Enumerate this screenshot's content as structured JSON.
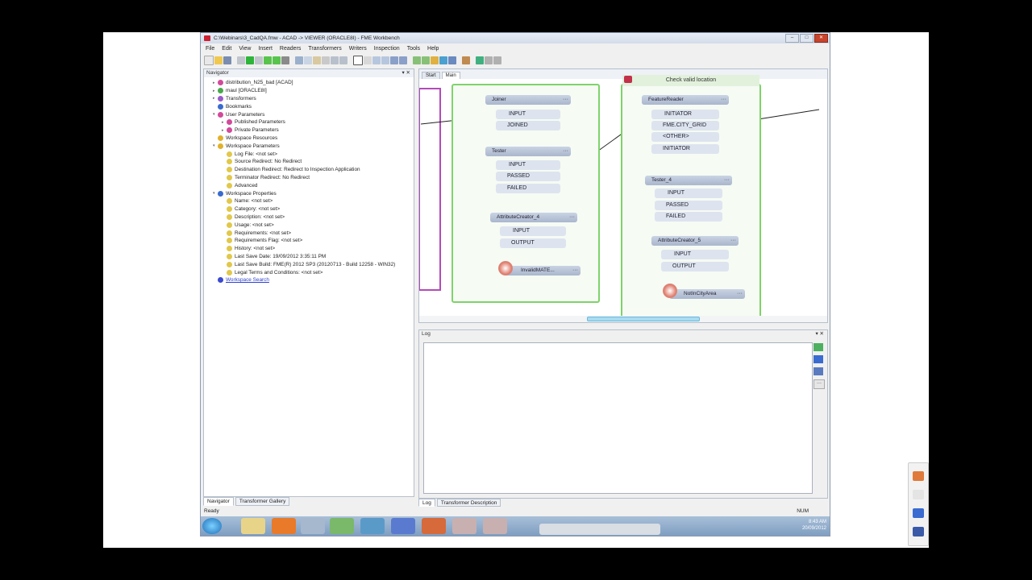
{
  "window": {
    "title": "C:\\Webinars\\3_CadQA.fmw - ACAD -> VIEWER (ORACLE8I) - FME Workbench"
  },
  "menu": [
    "File",
    "Edit",
    "View",
    "Insert",
    "Readers",
    "Transformers",
    "Writers",
    "Inspection",
    "Tools",
    "Help"
  ],
  "navigator": {
    "title": "Navigator",
    "items": [
      {
        "label": "distribution_N25_bad [ACAD]",
        "color": "#d24a9a"
      },
      {
        "label": "maul [ORACLE8I]",
        "color": "#4aa84a"
      },
      {
        "label": "Transformers",
        "color": "#9a5ac8"
      },
      {
        "label": "Bookmarks",
        "color": "#3a6bd0"
      },
      {
        "label": "User Parameters",
        "color": "#d24a9a"
      },
      {
        "label": "Published Parameters",
        "color": "#d24a9a"
      },
      {
        "label": "Private Parameters",
        "color": "#d24a9a"
      },
      {
        "label": "Workspace Resources",
        "color": "#e1b12c"
      },
      {
        "label": "Workspace Parameters",
        "color": "#e1b12c"
      },
      {
        "label": "Log File: <not set>",
        "color": "#e1c84a"
      },
      {
        "label": "Source Redirect: No Redirect",
        "color": "#e1c84a"
      },
      {
        "label": "Destination Redirect: Redirect to Inspection Application",
        "color": "#e1c84a"
      },
      {
        "label": "Terminator Redirect: No Redirect",
        "color": "#e1c84a"
      },
      {
        "label": "Advanced",
        "color": "#e1c84a"
      },
      {
        "label": "Workspace Properties",
        "color": "#3a6bd0"
      },
      {
        "label": "Name: <not set>",
        "color": "#e1c84a"
      },
      {
        "label": "Category: <not set>",
        "color": "#e1c84a"
      },
      {
        "label": "Description: <not set>",
        "color": "#e1c84a"
      },
      {
        "label": "Usage: <not set>",
        "color": "#e1c84a"
      },
      {
        "label": "Requirements: <not set>",
        "color": "#e1c84a"
      },
      {
        "label": "Requirements Flag: <not set>",
        "color": "#e1c84a"
      },
      {
        "label": "History: <not set>",
        "color": "#e1c84a"
      },
      {
        "label": "Last Save Date: 19/09/2012 3:35:11 PM",
        "color": "#e1c84a"
      },
      {
        "label": "Last Save Build: FME(R) 2012 SP3 (20120713 - Build 12258 - WIN32)",
        "color": "#e1c84a"
      },
      {
        "label": "Legal Terms and Conditions: <not set>",
        "color": "#e1c84a"
      },
      {
        "label": "Workspace Search",
        "color": "#3a4ad0"
      }
    ],
    "tabs": [
      "Navigator",
      "Transformer Gallery"
    ]
  },
  "canvas": {
    "tabs": [
      "Start",
      "Main"
    ],
    "bookmark_title": "Check valid location",
    "transformers_left": [
      {
        "name": "Joiner",
        "ports": [
          "INPUT",
          "JOINED"
        ]
      },
      {
        "name": "Tester",
        "ports": [
          "INPUT",
          "PASSED",
          "FAILED"
        ]
      },
      {
        "name": "AttributeCreator_4",
        "ports": [
          "INPUT",
          "OUTPUT"
        ]
      },
      {
        "name": "InvalidMATE..."
      }
    ],
    "transformers_right": [
      {
        "name": "FeatureReader",
        "ports": [
          "INITIATOR",
          "FME.CITY_GRID",
          "<OTHER>",
          "INITIATOR"
        ]
      },
      {
        "name": "Tester_4",
        "ports": [
          "INPUT",
          "PASSED",
          "FAILED"
        ]
      },
      {
        "name": "AttributeCreator_5",
        "ports": [
          "INPUT",
          "OUTPUT"
        ]
      },
      {
        "name": "NotInCityArea"
      }
    ]
  },
  "log": {
    "title": "Log",
    "tabs": [
      "Log",
      "Transformer Description"
    ]
  },
  "status": {
    "text": "Ready",
    "num": "NUM"
  },
  "taskbar": {
    "time": "8:43 AM",
    "date": "20/09/2012"
  }
}
